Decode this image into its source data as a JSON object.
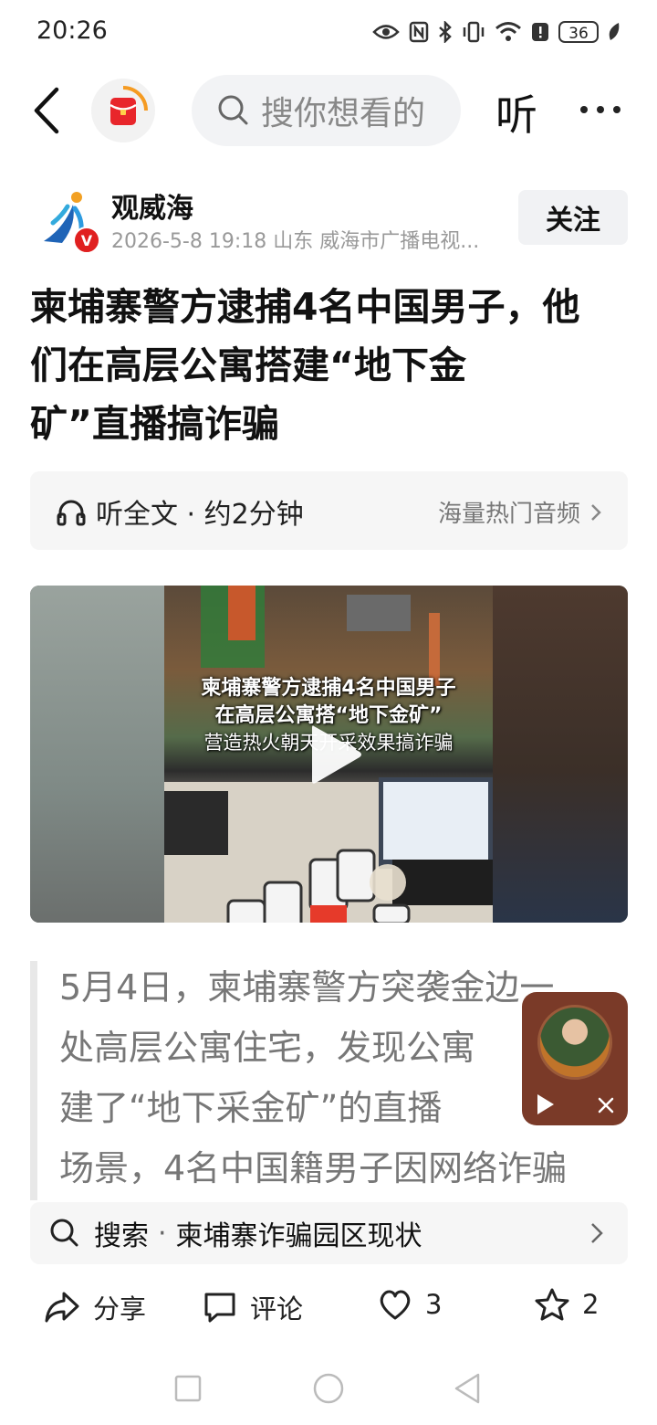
{
  "status_bar": {
    "time": "20:26",
    "battery": "36"
  },
  "nav": {
    "search_placeholder": "搜你想看的",
    "listen_label": "听"
  },
  "author": {
    "name": "观威海",
    "badge": "V",
    "meta": "2026-5-8  19:18  山东  威海市广播电视...",
    "follow_label": "关注"
  },
  "article": {
    "title_lines": [
      "柬埔寨警方逮捕4名中国男子，他",
      "们在高层公寓搭建“地下金",
      "矿”直播搞诈骗"
    ]
  },
  "listen_bar": {
    "label": "听全文 · 约2分钟",
    "right_label": "海量热门音频"
  },
  "video": {
    "caption_lines": [
      "柬埔寨警方逮捕4名中国男子",
      "在高层公寓搭“地下金矿”",
      "营造热火朝天开采效果搞诈骗"
    ]
  },
  "quote_lines": [
    "5月4日，柬埔寨警方突袭金边一",
    "处高层公寓住宅，发现公寓",
    "建了“地下采金矿”的直播",
    "场景，4名中国籍男子因网络诈骗"
  ],
  "search_suggest": {
    "prefix": "搜索",
    "query": "柬埔寨诈骗园区现状"
  },
  "actions": {
    "share": "分享",
    "comment": "评论",
    "likes": "3",
    "favorites": "2"
  },
  "icons": [
    "eye-icon",
    "nfc-icon",
    "bluetooth-icon",
    "vibrate-icon",
    "wifi-icon",
    "alert-icon",
    "battery-icon",
    "leaf-icon",
    "back-icon",
    "search-icon",
    "more-icon",
    "headphone-icon",
    "chevron-right-icon",
    "play-icon",
    "close-icon",
    "share-icon",
    "comment-icon",
    "heart-icon",
    "star-icon"
  ],
  "colors": {
    "accent_red": "#e02020",
    "floating_bg": "#7a3a28"
  }
}
